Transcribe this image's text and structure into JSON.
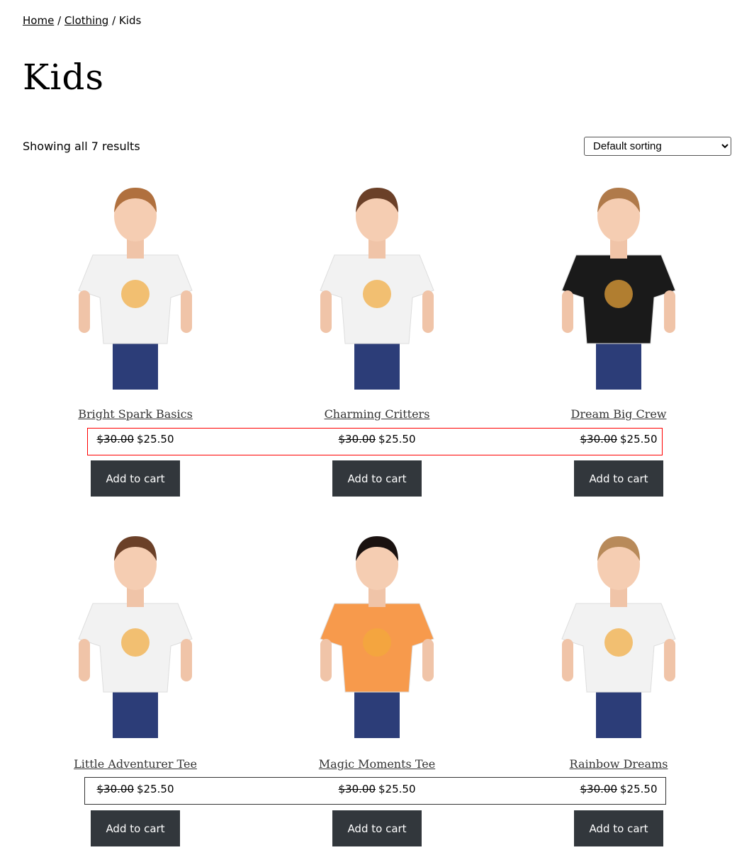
{
  "breadcrumb": {
    "items": [
      {
        "label": "Home"
      },
      {
        "label": "Clothing"
      }
    ],
    "current": "Kids",
    "separator": "/"
  },
  "page_title": "Kids",
  "result_count": "Showing all 7 results",
  "sorting": {
    "selected": "Default sorting"
  },
  "products": [
    {
      "name": "Bright Spark Basics",
      "regular_price": "$30.00",
      "sale_price": "$25.50",
      "button": "Add to cart",
      "shirt_color": "#f2f2f2",
      "hair_color": "#b0703e"
    },
    {
      "name": "Charming Critters",
      "regular_price": "$30.00",
      "sale_price": "$25.50",
      "button": "Add to cart",
      "shirt_color": "#f2f2f2",
      "hair_color": "#6b4028"
    },
    {
      "name": "Dream Big Crew",
      "regular_price": "$30.00",
      "sale_price": "$25.50",
      "button": "Add to cart",
      "shirt_color": "#1a1a1a",
      "hair_color": "#b07a4a"
    },
    {
      "name": "Little Adventurer Tee",
      "regular_price": "$30.00",
      "sale_price": "$25.50",
      "button": "Add to cart",
      "shirt_color": "#f2f2f2",
      "hair_color": "#6b4028"
    },
    {
      "name": "Magic Moments Tee",
      "regular_price": "$30.00",
      "sale_price": "$25.50",
      "button": "Add to cart",
      "shirt_color": "#f79a4c",
      "hair_color": "#1a1210"
    },
    {
      "name": "Rainbow Dreams",
      "regular_price": "$30.00",
      "sale_price": "$25.50",
      "button": "Add to cart",
      "shirt_color": "#f2f2f2",
      "hair_color": "#b88a5a"
    }
  ],
  "colors": {
    "button_bg": "#32373c",
    "row1_price_border": "#ff0000",
    "row2_price_border": "#333333"
  }
}
